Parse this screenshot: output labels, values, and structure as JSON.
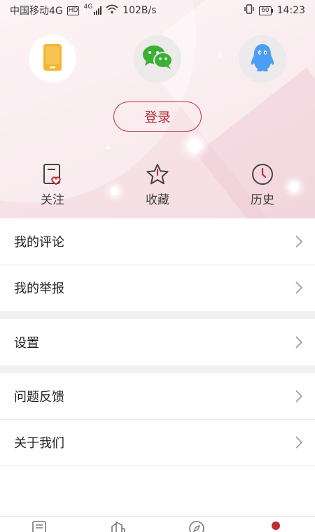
{
  "status_bar": {
    "carrier": "中国移动4G",
    "hd": "HD",
    "net_type": "4G",
    "speed": "102B/s",
    "battery": "60",
    "time": "14:23"
  },
  "social_logins": [
    {
      "name": "phone",
      "icon": "phone-icon",
      "color": "#f2b630"
    },
    {
      "name": "wechat",
      "icon": "wechat-icon",
      "color": "#3cb034"
    },
    {
      "name": "qq",
      "icon": "qq-icon",
      "color": "#4a9ff5"
    }
  ],
  "login_button": "登录",
  "quick_links": [
    {
      "label": "关注",
      "icon": "follow-icon"
    },
    {
      "label": "收藏",
      "icon": "star-icon"
    },
    {
      "label": "历史",
      "icon": "clock-icon"
    }
  ],
  "menu": {
    "group1": [
      "我的评论",
      "我的举报"
    ],
    "group2": [
      "设置"
    ],
    "group3": [
      "问题反馈",
      "关于我们"
    ]
  },
  "tab_bar": [
    "news-icon",
    "building-icon",
    "compass-icon",
    "profile-icon"
  ],
  "colors": {
    "accent": "#b8353a",
    "hero_bg": "#f7e3e8",
    "divider_gap": "#f1f0f3"
  }
}
